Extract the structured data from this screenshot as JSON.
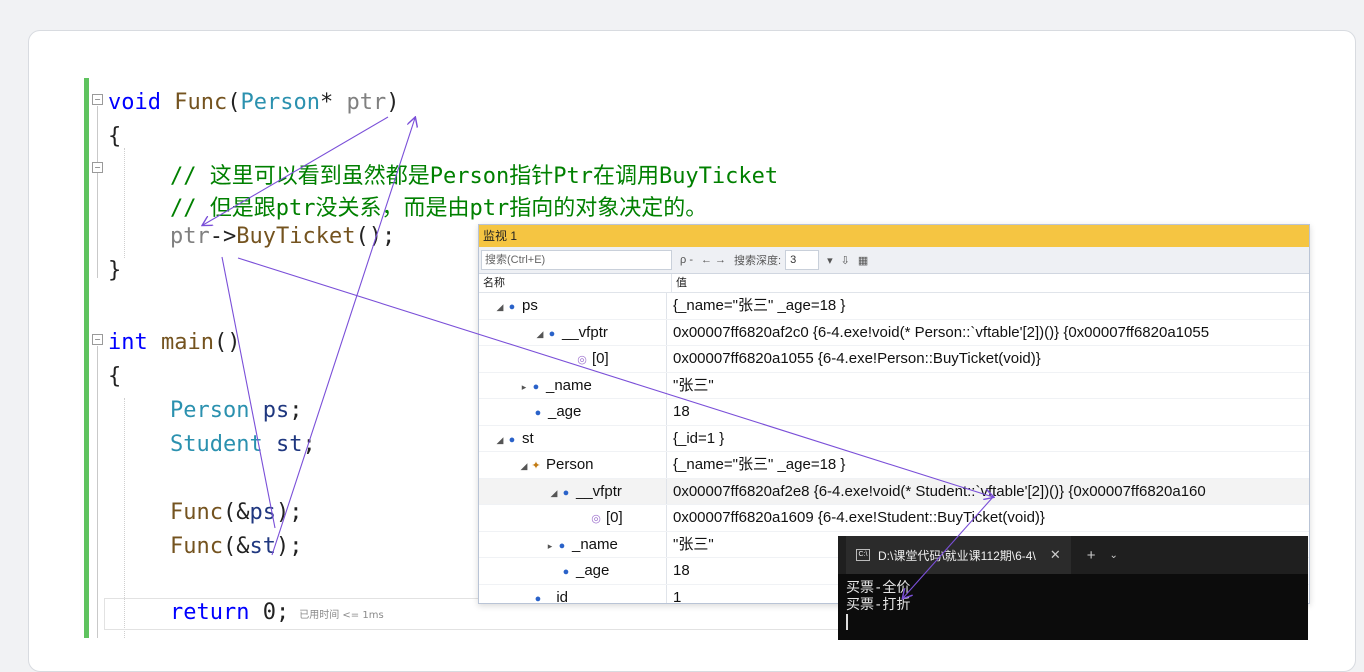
{
  "code": {
    "line1": {
      "kw": "void",
      "fn": "Func",
      "open": "(",
      "type": "Person",
      "star": "* ",
      "param": "ptr",
      "close": ")"
    },
    "line2": "{",
    "comment1": "// 这里可以看到虽然都是Person指针Ptr在调用BuyTicket",
    "comment2": "// 但是跟ptr没关系，而是由ptr指向的对象决定的。",
    "line5": {
      "var": "ptr",
      "arrow": "->",
      "fn": "BuyTicket",
      "tail": "();"
    },
    "line6": "}",
    "line8": {
      "kw": "int",
      "fn": "main",
      "tail": "()"
    },
    "line9": "{",
    "line10": {
      "type": "Person",
      "var": "ps",
      "semi": ";"
    },
    "line11": {
      "type": "Student",
      "var": "st",
      "semi": ";"
    },
    "line13": {
      "fn": "Func",
      "open": "(&",
      "var": "ps",
      "tail": ");"
    },
    "line14": {
      "fn": "Func",
      "open": "(&",
      "var": "st",
      "tail": ");"
    },
    "line16": {
      "kw": "return",
      "num": "0",
      "semi": ";",
      "elapsed": "已用时间 <= 1ms"
    }
  },
  "watch": {
    "title": "监视 1",
    "search_placeholder": "搜索(Ctrl+E)",
    "search_icon_label": "ρ -",
    "nav": "← →",
    "depth_label": "搜索深度:",
    "depth_value": "3",
    "col_name": "名称",
    "col_value": "值",
    "rows": [
      {
        "name": "ps",
        "value": "{_name=\"张三\" _age=18 }"
      },
      {
        "name": "__vfptr",
        "value": "0x00007ff6820af2c0 {6-4.exe!void(* Person::`vftable'[2])()} {0x00007ff6820a1055"
      },
      {
        "name": "[0]",
        "value": "0x00007ff6820a1055 {6-4.exe!Person::BuyTicket(void)}"
      },
      {
        "name": "_name",
        "value": "\"张三\""
      },
      {
        "name": "_age",
        "value": "18"
      },
      {
        "name": "st",
        "value": "{_id=1 }"
      },
      {
        "name": "Person",
        "value": "{_name=\"张三\" _age=18 }"
      },
      {
        "name": "__vfptr",
        "value": "0x00007ff6820af2e8 {6-4.exe!void(* Student::`vftable'[2])()} {0x00007ff6820a160"
      },
      {
        "name": "[0]",
        "value": "0x00007ff6820a1609 {6-4.exe!Student::BuyTicket(void)}"
      },
      {
        "name": "_name",
        "value": "\"张三\""
      },
      {
        "name": "_age",
        "value": "18"
      },
      {
        "name": "_id",
        "value": "1"
      }
    ]
  },
  "terminal": {
    "tab_title": "D:\\课堂代码\\就业课112期\\6-4\\",
    "close": "✕",
    "plus": "+",
    "dropdown": "⌄",
    "lines": [
      "买票-全价",
      "买票-打折"
    ]
  }
}
